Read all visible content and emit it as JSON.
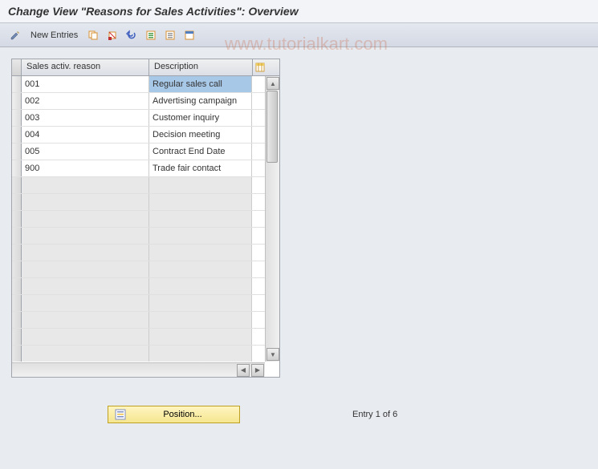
{
  "title": "Change View \"Reasons for Sales Activities\": Overview",
  "toolbar": {
    "new_entries": "New Entries"
  },
  "watermark": "www.tutorialkart.com",
  "table": {
    "headers": {
      "col1": "Sales activ. reason",
      "col2": "Description"
    },
    "rows": [
      {
        "code": "001",
        "desc": "Regular sales call",
        "selected": true
      },
      {
        "code": "002",
        "desc": "Advertising campaign"
      },
      {
        "code": "003",
        "desc": "Customer inquiry"
      },
      {
        "code": "004",
        "desc": "Decision meeting"
      },
      {
        "code": "005",
        "desc": "Contract End Date"
      },
      {
        "code": "900",
        "desc": "Trade fair contact"
      }
    ]
  },
  "footer": {
    "position_label": "Position...",
    "entry_text": "Entry 1 of 6"
  }
}
